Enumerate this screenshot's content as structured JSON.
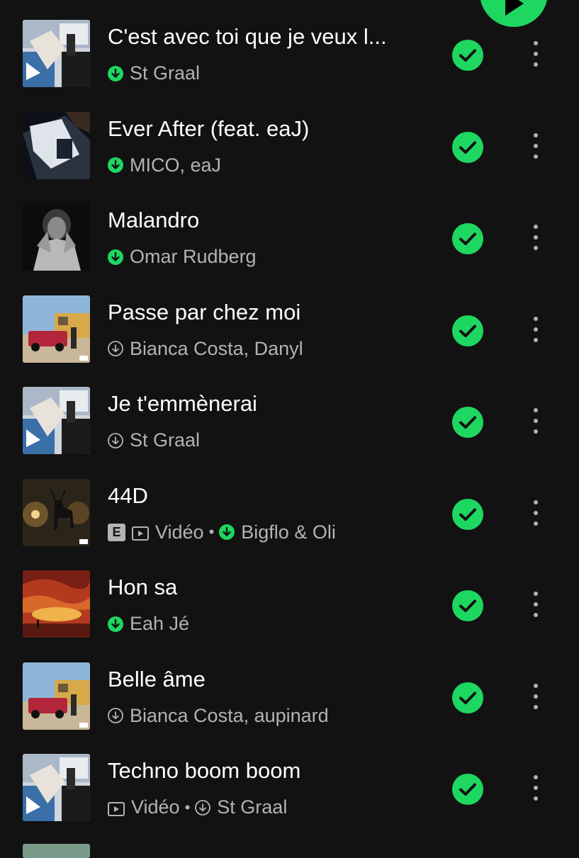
{
  "play_button": {
    "icon": "play-icon",
    "color": "#1ed760"
  },
  "accent_color": "#1ed760",
  "tracks": [
    {
      "title": "C'est avec toi que je veux l...",
      "artist": "St Graal",
      "downloaded": true,
      "explicit": false,
      "video": false,
      "cover": "st-graal"
    },
    {
      "title": "Ever After (feat. eaJ)",
      "artist": "MICO, eaJ",
      "downloaded": true,
      "explicit": false,
      "video": false,
      "cover": "ever-after"
    },
    {
      "title": "Malandro",
      "artist": "Omar Rudberg",
      "downloaded": true,
      "explicit": false,
      "video": false,
      "cover": "malandro"
    },
    {
      "title": "Passe par chez moi",
      "artist": "Bianca Costa, Danyl",
      "downloaded": false,
      "explicit": false,
      "video": false,
      "cover": "bianca"
    },
    {
      "title": "Je t'emmènerai",
      "artist": "St Graal",
      "downloaded": false,
      "explicit": false,
      "video": false,
      "cover": "st-graal"
    },
    {
      "title": "44D",
      "artist": "Bigflo & Oli",
      "downloaded": true,
      "explicit": true,
      "explicit_label": "E",
      "video": true,
      "video_label": "Vidéo",
      "cover": "deer"
    },
    {
      "title": "Hon sa",
      "artist": "Eah Jé",
      "downloaded": true,
      "explicit": false,
      "video": false,
      "cover": "sunset"
    },
    {
      "title": "Belle âme",
      "artist": "Bianca Costa, aupinard",
      "downloaded": false,
      "explicit": false,
      "video": false,
      "cover": "bianca"
    },
    {
      "title": "Techno boom boom",
      "artist": "St Graal",
      "downloaded": false,
      "explicit": false,
      "video": true,
      "video_label": "Vidéo",
      "cover": "st-graal"
    }
  ],
  "row_icons": {
    "added": "check-circle-icon",
    "more": "more-vertical-icon",
    "download": "download-icon"
  }
}
